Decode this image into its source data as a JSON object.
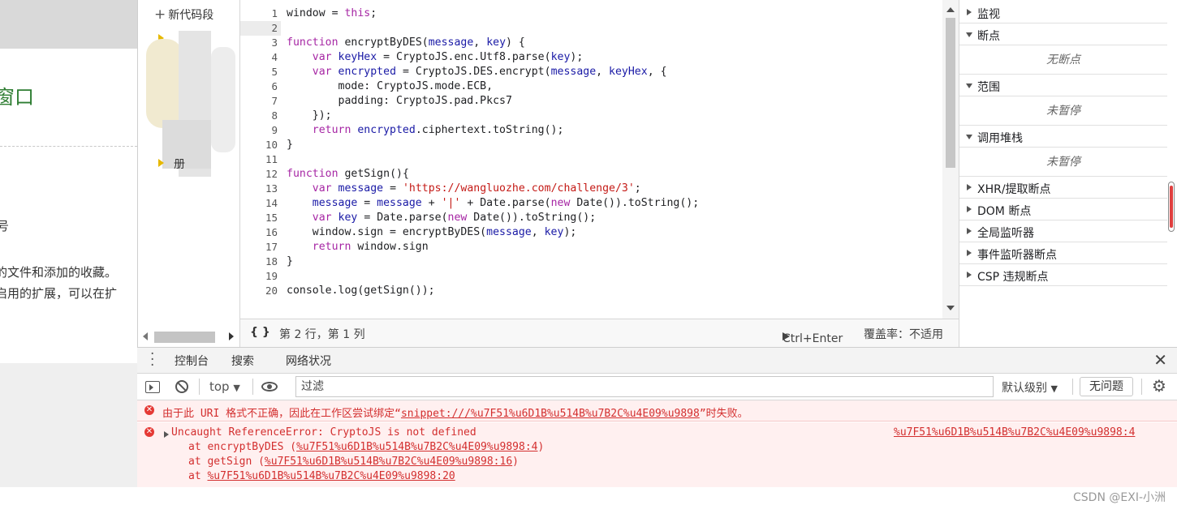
{
  "left_page": {
    "heading_fragment": "窗口",
    "line_a": "号",
    "line_b": "的文件和添加的收藏。",
    "line_c": "启用的扩展，可以在扩",
    "accent_color": "#2e7d32"
  },
  "navigator": {
    "new_snippet_label": "新代码段",
    "file_item_fragment": "册"
  },
  "editor": {
    "current_line": 2,
    "lines": [
      {
        "n": "1",
        "html": "window = <k>this</k>;"
      },
      {
        "n": "2",
        "html": ""
      },
      {
        "n": "3",
        "html": "<k>function</k> <f>encryptByDES</f>(<v>message</v>, <v>key</v>) {"
      },
      {
        "n": "4",
        "html": "    <k>var</k> <v>keyHex</v> = CryptoJS.enc.Utf8.parse(<v>key</v>);"
      },
      {
        "n": "5",
        "html": "    <k>var</k> <v>encrypted</v> = CryptoJS.DES.encrypt(<v>message</v>, <v>keyHex</v>, {"
      },
      {
        "n": "6",
        "html": "        mode: CryptoJS.mode.ECB,"
      },
      {
        "n": "7",
        "html": "        padding: CryptoJS.pad.Pkcs7"
      },
      {
        "n": "8",
        "html": "    });"
      },
      {
        "n": "9",
        "html": "    <k>return</k> <v>encrypted</v>.ciphertext.toString();"
      },
      {
        "n": "10",
        "html": "}"
      },
      {
        "n": "11",
        "html": ""
      },
      {
        "n": "12",
        "html": "<k>function</k> <f>getSign</f>(){"
      },
      {
        "n": "13",
        "html": "    <k>var</k> <v>message</v> = <s>'https://wangluozhe.com/challenge/3'</s>;"
      },
      {
        "n": "14",
        "html": "    <v>message</v> = <v>message</v> + <s>'|'</s> + Date.parse(<k>new</k> Date()).toString();"
      },
      {
        "n": "15",
        "html": "    <k>var</k> <v>key</v> = Date.parse(<k>new</k> Date()).toString();"
      },
      {
        "n": "16",
        "html": "    window.sign = encryptByDES(<v>message</v>, <v>key</v>);"
      },
      {
        "n": "17",
        "html": "    <k>return</k> window.sign"
      },
      {
        "n": "18",
        "html": "}"
      },
      {
        "n": "19",
        "html": ""
      },
      {
        "n": "20",
        "html": "console.log(getSign());"
      }
    ],
    "colors": {
      "keyword": "#a626a4",
      "string": "#c41a16",
      "variable": "#1a1aa6",
      "function": "#202124"
    }
  },
  "statusbar": {
    "braces_icon": "{ }",
    "position": "第 2 行，第 1 列",
    "run_label": "Ctrl+Enter",
    "coverage": "覆盖率：不适用"
  },
  "debugger": {
    "watch": "监视",
    "breakpoints": "断点",
    "no_breakpoints": "无断点",
    "scope": "范围",
    "not_paused_1": "未暂停",
    "callstack": "调用堆栈",
    "not_paused_2": "未暂停",
    "xhr": "XHR/提取断点",
    "dom": "DOM 断点",
    "global": "全局监听器",
    "event": "事件监听器断点",
    "csp": "CSP 违规断点"
  },
  "drawer": {
    "tab_console": "控制台",
    "tab_search": "搜索",
    "tab_network": "网络状况"
  },
  "console_toolbar": {
    "context": "top",
    "filter_placeholder": "过滤",
    "level": "默认级别",
    "issues": "无问题"
  },
  "messages": {
    "msg1_prefix": "由于此 URI 格式不正确，因此在工作区尝试绑定“",
    "msg1_link": "snippet:///%u7F51%u6D1B%u514B%u7B2C%u4E09%u9898",
    "msg1_suffix": "”时失败。",
    "msg2_head": "Uncaught ReferenceError: CryptoJS is not defined",
    "msg2_source": "%u7F51%u6D1B%u514B%u7B2C%u4E09%u9898:4",
    "stack1_at": "at encryptByDES (",
    "stack1_link": "%u7F51%u6D1B%u514B%u7B2C%u4E09%u9898:4",
    "stack2_at": "at getSign (",
    "stack2_link": "%u7F51%u6D1B%u514B%u7B2C%u4E09%u9898:16",
    "stack3_at": "at ",
    "stack3_link": "%u7F51%u6D1B%u514B%u7B2C%u4E09%u9898:20",
    "close_paren": ")"
  },
  "watermark": "CSDN @EXI-小洲"
}
